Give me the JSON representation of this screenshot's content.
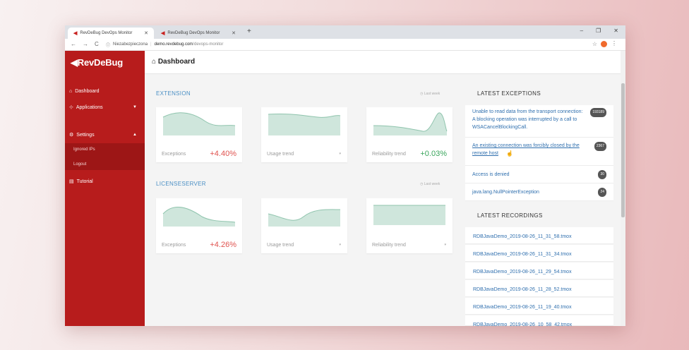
{
  "browser": {
    "tabs": [
      {
        "label": "RevDeBug DevOps Monitor",
        "active": true
      },
      {
        "label": "RevDeBug DevOps Monitor",
        "active": false
      }
    ],
    "new_tab": "+",
    "win_controls": [
      "–",
      "❐",
      "✕"
    ],
    "nav": [
      "←",
      "→",
      "C"
    ],
    "security": "Niezabezpieczona",
    "url_host": "demo.revdebug.com",
    "url_path": "/devops-monitor"
  },
  "sidebar": {
    "brand": "◀RevDeBug",
    "items": [
      {
        "label": "Dashboard",
        "icon": "home-icon"
      },
      {
        "label": "Applications",
        "icon": "sitemap-icon"
      },
      {
        "label": "Settings",
        "icon": "gear-icon"
      },
      {
        "label": "Ignored IPs"
      },
      {
        "label": "Logout"
      },
      {
        "label": "Tutorial",
        "icon": "book-icon"
      }
    ]
  },
  "header": {
    "title": "Dashboard"
  },
  "extension": {
    "title": "EXTENSION",
    "last_week": "Last week",
    "cards": [
      {
        "label": "Exceptions",
        "value": "+4.40%"
      },
      {
        "label": "Usage trend",
        "value": ""
      },
      {
        "label": "Reliability trend",
        "value": "+0.03%"
      }
    ]
  },
  "licenseserver": {
    "title": "LICENSESERVER",
    "last_week": "Last week",
    "cards": [
      {
        "label": "Exceptions",
        "value": "+4.26%"
      },
      {
        "label": "Usage trend",
        "value": ""
      },
      {
        "label": "Reliability trend",
        "value": ""
      }
    ]
  },
  "exceptions": {
    "title": "LATEST EXCEPTIONS",
    "items": [
      {
        "text": "Unable to read data from the transport connection: A blocking operation was interrupted by a call to WSACancelBlockingCall.",
        "count": "193189"
      },
      {
        "text": "An existing connection was forcibly closed by the remote host",
        "count": "2367"
      },
      {
        "text": "Access is denied",
        "count": "30"
      },
      {
        "text": "java.lang.NullPointerException",
        "count": "24"
      }
    ]
  },
  "recordings": {
    "title": "LATEST RECORDINGS",
    "items": [
      "RDBJavaDemo_2019-08-26_11_31_58.tmox",
      "RDBJavaDemo_2019-08-26_11_31_34.tmox",
      "RDBJavaDemo_2019-08-26_11_29_54.tmox",
      "RDBJavaDemo_2019-08-26_11_28_52.tmox",
      "RDBJavaDemo_2019-08-26_11_19_40.tmox",
      "RDBJavaDemo_2019-08-26_10_58_42.tmox"
    ]
  },
  "colors": {
    "sidebar": "#b71c1c",
    "link": "#2f6fae",
    "negative": "#e0534f",
    "positive": "#3aa55c",
    "spark": "#cfe6dc"
  }
}
